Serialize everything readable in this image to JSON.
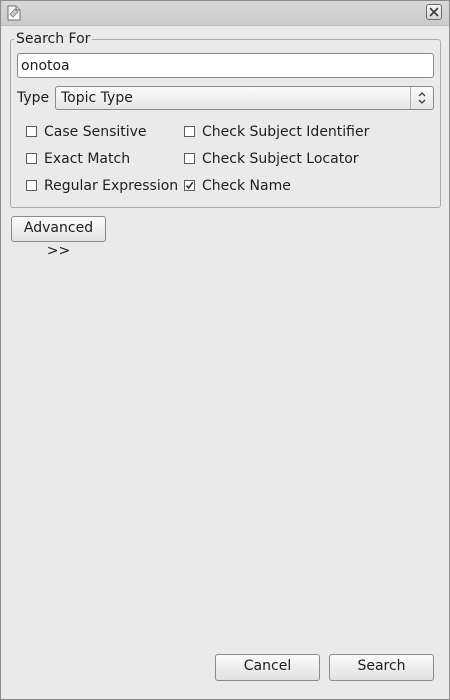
{
  "window": {
    "title": ""
  },
  "search_for": {
    "legend": "Search For",
    "query_value": "onotoa",
    "type_label": "Type",
    "type_selected": "Topic Type"
  },
  "options": [
    {
      "label": "Case Sensitive",
      "checked": false
    },
    {
      "label": "Exact Match",
      "checked": false
    },
    {
      "label": "Regular Expression",
      "checked": false
    },
    {
      "label": "Check Subject Identifier",
      "checked": false
    },
    {
      "label": "Check Subject Locator",
      "checked": false
    },
    {
      "label": "Check Name",
      "checked": true
    }
  ],
  "buttons": {
    "advanced": "Advanced >>",
    "cancel": "Cancel",
    "search": "Search"
  },
  "icons": {
    "app": "document-icon",
    "close": "close-icon",
    "select": "updown-arrows-icon",
    "check": "checkmark-icon"
  }
}
